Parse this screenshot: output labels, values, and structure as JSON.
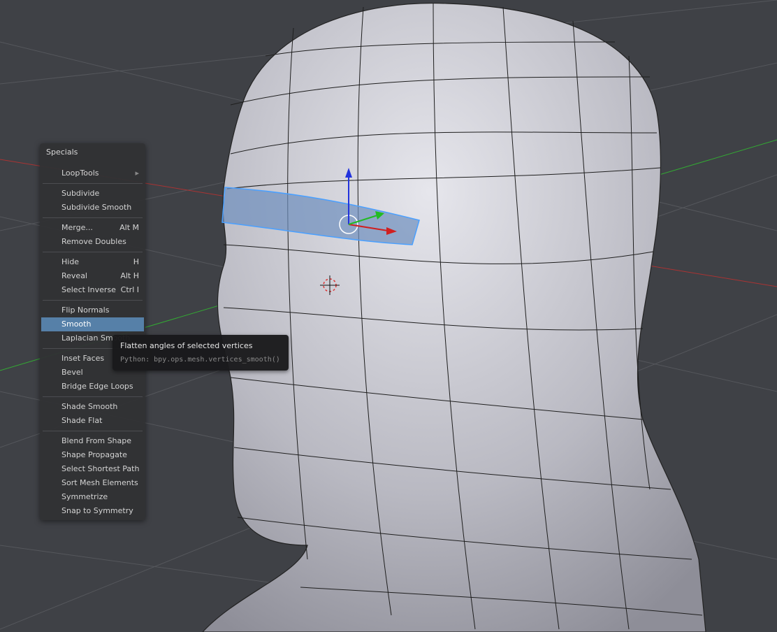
{
  "menu": {
    "title": "Specials",
    "groups": [
      [
        {
          "label": "LoopTools",
          "submenu": true
        }
      ],
      [
        {
          "label": "Subdivide"
        },
        {
          "label": "Subdivide Smooth"
        }
      ],
      [
        {
          "label": "Merge...",
          "shortcut": "Alt M"
        },
        {
          "label": "Remove Doubles"
        }
      ],
      [
        {
          "label": "Hide",
          "shortcut": "H"
        },
        {
          "label": "Reveal",
          "shortcut": "Alt H"
        },
        {
          "label": "Select Inverse",
          "shortcut": "Ctrl I"
        }
      ],
      [
        {
          "label": "Flip Normals"
        },
        {
          "label": "Smooth",
          "active": true
        },
        {
          "label": "Laplacian Smooth"
        }
      ],
      [
        {
          "label": "Inset Faces"
        },
        {
          "label": "Bevel"
        },
        {
          "label": "Bridge Edge Loops"
        }
      ],
      [
        {
          "label": "Shade Smooth"
        },
        {
          "label": "Shade Flat"
        }
      ],
      [
        {
          "label": "Blend From Shape"
        },
        {
          "label": "Shape Propagate"
        },
        {
          "label": "Select Shortest Path"
        },
        {
          "label": "Sort Mesh Elements"
        },
        {
          "label": "Symmetrize"
        },
        {
          "label": "Snap to Symmetry"
        }
      ]
    ]
  },
  "tooltip": {
    "title": "Flatten angles of selected vertices",
    "python": "Python: bpy.ops.mesh.vertices_smooth()"
  },
  "colors": {
    "viewport_bg": "#3f4146",
    "menu_highlight": "#5680a8",
    "x_axis": "#c0392b",
    "y_axis": "#2ea02e",
    "z_axis": "#2233dd",
    "selection": "#5b8fd0"
  }
}
